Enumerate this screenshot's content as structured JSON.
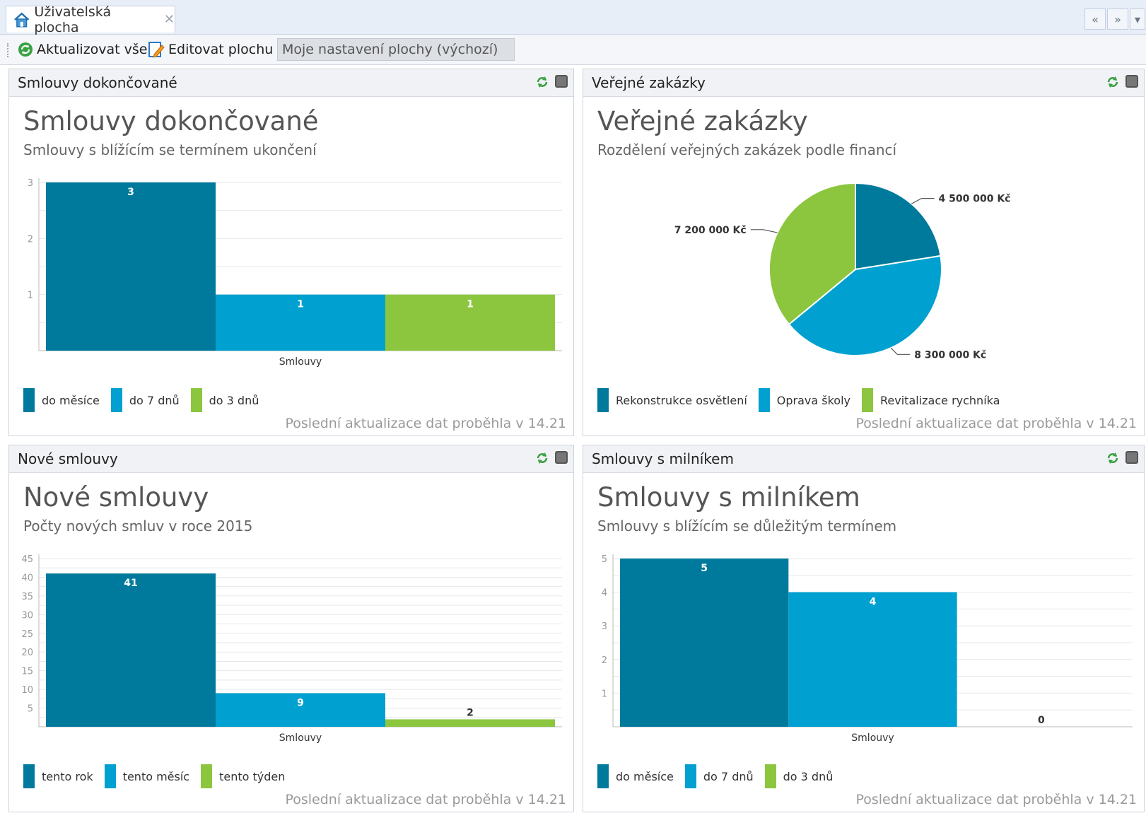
{
  "tab": {
    "label": "Uživatelská plocha"
  },
  "nav": {
    "prev": "«",
    "next": "»"
  },
  "toolbar": {
    "refresh_all": "Aktualizovat vše",
    "edit": "Editovat plochu",
    "layout": "Moje nastavení plochy (výchozí)"
  },
  "colors": {
    "dark": "#007a9c",
    "mid": "#00a0d0",
    "green": "#8cc63f"
  },
  "panels": [
    {
      "header": "Smlouvy dokončované",
      "title": "Smlouvy dokončované",
      "subtitle": "Smlouvy s blížícím se termínem ukončení",
      "footer": "Poslední aktualizace dat proběhla v 14.21",
      "legend": [
        "do měsíce",
        "do 7 dnů",
        "do 3 dnů"
      ]
    },
    {
      "header": "Veřejné zakázky",
      "title": "Veřejné zakázky",
      "subtitle": "Rozdělení veřejných zakázek podle financí",
      "footer": "Poslední aktualizace dat proběhla v 14.21",
      "legend": [
        "Rekonstrukce osvětlení",
        "Oprava školy",
        "Revitalizace rychníka"
      ]
    },
    {
      "header": "Nové smlouvy",
      "title": "Nové smlouvy",
      "subtitle": "Počty nových smluv v roce 2015",
      "footer": "Poslední aktualizace dat proběhla v 14.21",
      "legend": [
        "tento rok",
        "tento měsíc",
        "tento týden"
      ]
    },
    {
      "header": "Smlouvy s milníkem",
      "title": "Smlouvy s milníkem",
      "subtitle": "Smlouvy s blížícím se důležitým termínem",
      "footer": "Poslední aktualizace dat proběhla v 14.21",
      "legend": [
        "do měsíce",
        "do 7 dnů",
        "do 3 dnů"
      ]
    }
  ],
  "chart_data": [
    {
      "type": "bar",
      "categories": [
        "Smlouvy"
      ],
      "series": [
        {
          "name": "do měsíce",
          "values": [
            3
          ]
        },
        {
          "name": "do 7 dnů",
          "values": [
            1
          ]
        },
        {
          "name": "do 3 dnů",
          "values": [
            1
          ]
        }
      ],
      "yticks": [
        1,
        2,
        3
      ],
      "ylim": [
        0,
        3
      ],
      "xlabel": "Smlouvy"
    },
    {
      "type": "pie",
      "slices": [
        {
          "name": "Rekonstrukce osvětlení",
          "value": 4500000,
          "label": "4 500 000 Kč"
        },
        {
          "name": "Oprava školy",
          "value": 8300000,
          "label": "8 300 000 Kč"
        },
        {
          "name": "Revitalizace rychníka",
          "value": 7200000,
          "label": "7 200 000 Kč"
        }
      ]
    },
    {
      "type": "bar",
      "categories": [
        "Smlouvy"
      ],
      "series": [
        {
          "name": "tento rok",
          "values": [
            41
          ]
        },
        {
          "name": "tento měsíc",
          "values": [
            9
          ]
        },
        {
          "name": "tento týden",
          "values": [
            2
          ]
        }
      ],
      "yticks": [
        5,
        10,
        15,
        20,
        25,
        30,
        35,
        40,
        45
      ],
      "ylim": [
        0,
        45
      ],
      "xlabel": "Smlouvy"
    },
    {
      "type": "bar",
      "categories": [
        "Smlouvy"
      ],
      "series": [
        {
          "name": "do měsíce",
          "values": [
            5
          ]
        },
        {
          "name": "do 7 dnů",
          "values": [
            4
          ]
        },
        {
          "name": "do 3 dnů",
          "values": [
            0
          ]
        }
      ],
      "yticks": [
        1,
        2,
        3,
        4,
        5
      ],
      "ylim": [
        0,
        5
      ],
      "xlabel": "Smlouvy"
    }
  ]
}
